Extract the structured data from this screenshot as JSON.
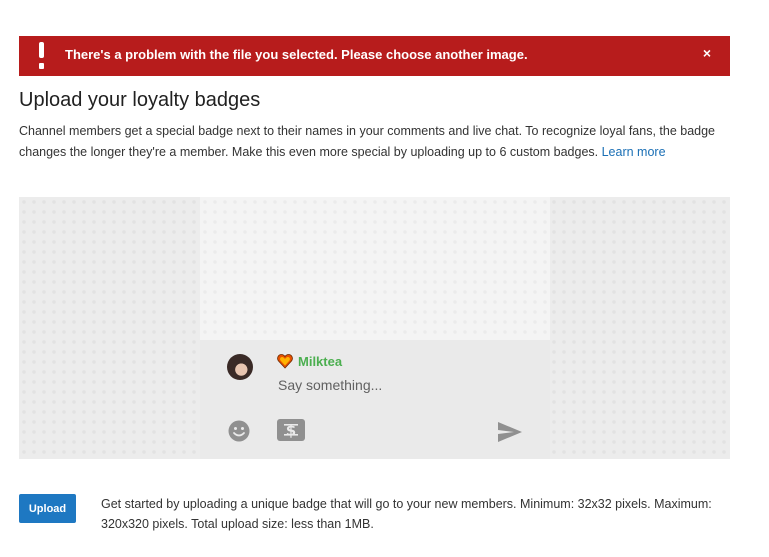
{
  "alert": {
    "message": "There's a problem with the file you selected. Please choose another image.",
    "close_glyph": "×",
    "icon": "exclamation-icon",
    "color": "#b71c1c"
  },
  "page": {
    "title": "Upload your loyalty badges",
    "description": "Channel members get a special badge next to their names in your comments and live chat. To recognize loyal fans, the badge changes the longer they're a member. Make this even more special by uploading up to 6 custom badges.",
    "learn_more": "Learn more",
    "link_color": "#1a6fb5"
  },
  "preview": {
    "username": "Milktea",
    "username_color": "#4caf50",
    "placeholder": "Say something...",
    "icons": [
      "emoji-icon",
      "super-chat-money-icon",
      "send-icon"
    ]
  },
  "upload": {
    "button_label": "Upload",
    "button_color": "#1e78c2",
    "help_text": "Get started by uploading a unique badge that will go to your new members. Minimum: 32x32 pixels. Maximum: 320x320 pixels. Total upload size: less than 1MB."
  }
}
